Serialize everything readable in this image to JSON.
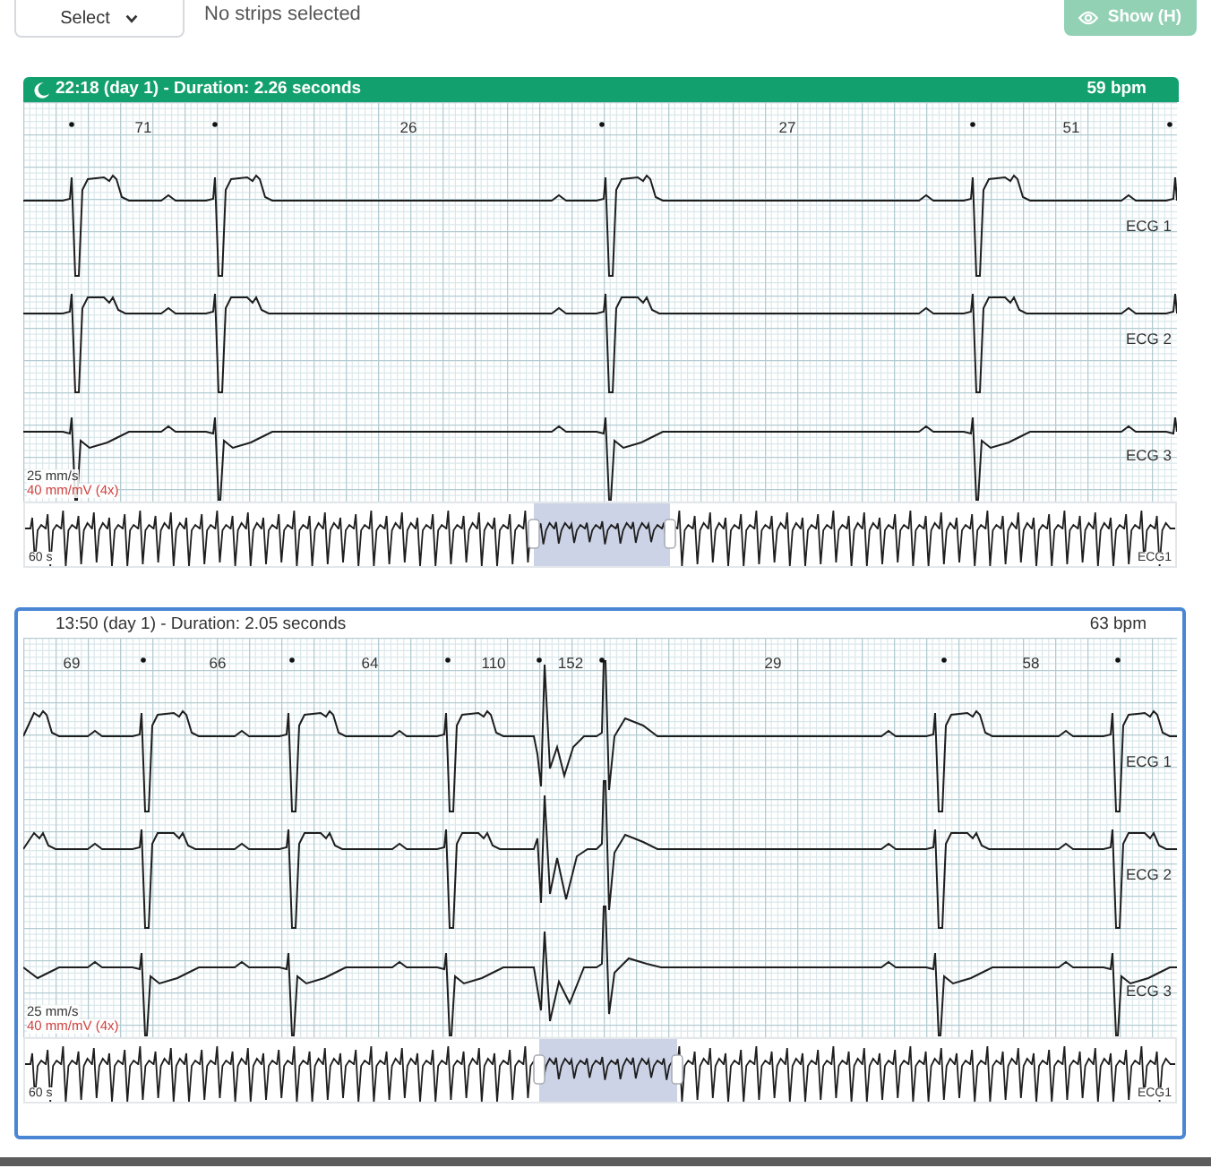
{
  "toolbar": {
    "select": {
      "label": "Select"
    },
    "status": "No strips selected",
    "show_button": {
      "label": "Show (H)",
      "disabled": true
    }
  },
  "strips": [
    {
      "title": "22:18 (day 1) - Duration: 2.26 seconds",
      "heart_rate": "59 bpm",
      "sleep": true,
      "highlighted": true,
      "focused": false,
      "intervals": [
        "71",
        "26",
        "27",
        "51"
      ],
      "leads": [
        "ECG 1",
        "ECG 2",
        "ECG 3"
      ],
      "speed": "25 mm/s",
      "gain": "40 mm/mV (4x)",
      "overview": {
        "duration": "60 s",
        "lead": "ECG1"
      }
    },
    {
      "title": "13:50 (day 1) - Duration: 2.05 seconds",
      "heart_rate": "63 bpm",
      "sleep": false,
      "highlighted": false,
      "focused": true,
      "intervals": [
        "69",
        "66",
        "64",
        "110",
        "152",
        "29",
        "58"
      ],
      "leads": [
        "ECG 1",
        "ECG 2",
        "ECG 3"
      ],
      "speed": "25 mm/s",
      "gain": "40 mm/mV (4x)",
      "overview": {
        "duration": "60 s",
        "lead": "ECG1"
      }
    }
  ]
}
